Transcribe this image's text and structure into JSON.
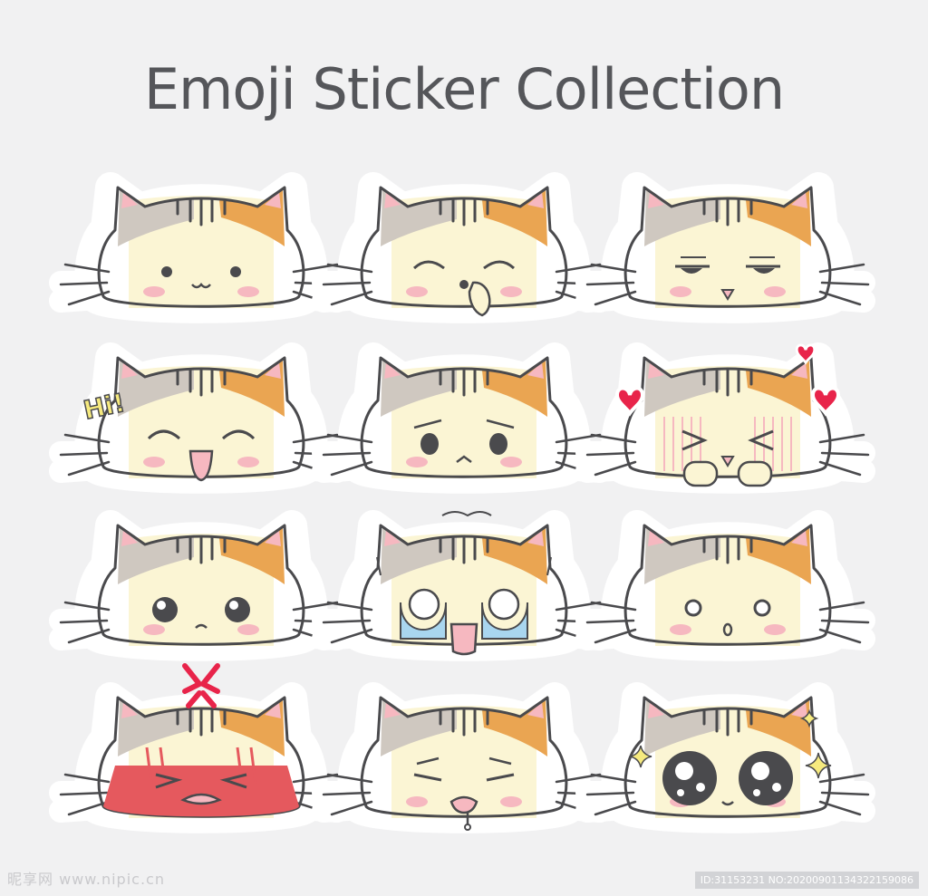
{
  "title": "Emoji Sticker Collection",
  "colors": {
    "background": "#f1f1f2",
    "face": "#fbf5d4",
    "outline": "#4a4a4d",
    "grey_patch": "#cfc8c0",
    "orange_patch": "#eaa552",
    "blush": "#f6b8c0",
    "heart": "#e8244a",
    "angry": "#e5595e",
    "tears": "#a9d6ef",
    "sparkle": "#f6ea7e"
  },
  "stickers": [
    {
      "expression": "neutral",
      "caption": ""
    },
    {
      "expression": "giggle",
      "caption": ""
    },
    {
      "expression": "unimpressed",
      "caption": ""
    },
    {
      "expression": "hi",
      "caption": "Hi!"
    },
    {
      "expression": "sad",
      "caption": ""
    },
    {
      "expression": "love",
      "caption": ""
    },
    {
      "expression": "teary",
      "caption": ""
    },
    {
      "expression": "crying",
      "caption": ""
    },
    {
      "expression": "surprised",
      "caption": ""
    },
    {
      "expression": "angry",
      "caption": ""
    },
    {
      "expression": "drool",
      "caption": ""
    },
    {
      "expression": "starry-eyed",
      "caption": ""
    }
  ],
  "watermark": {
    "left": "昵享网 www.nipic.cn",
    "right": "ID:31153231 NO:20200901134322159086"
  }
}
